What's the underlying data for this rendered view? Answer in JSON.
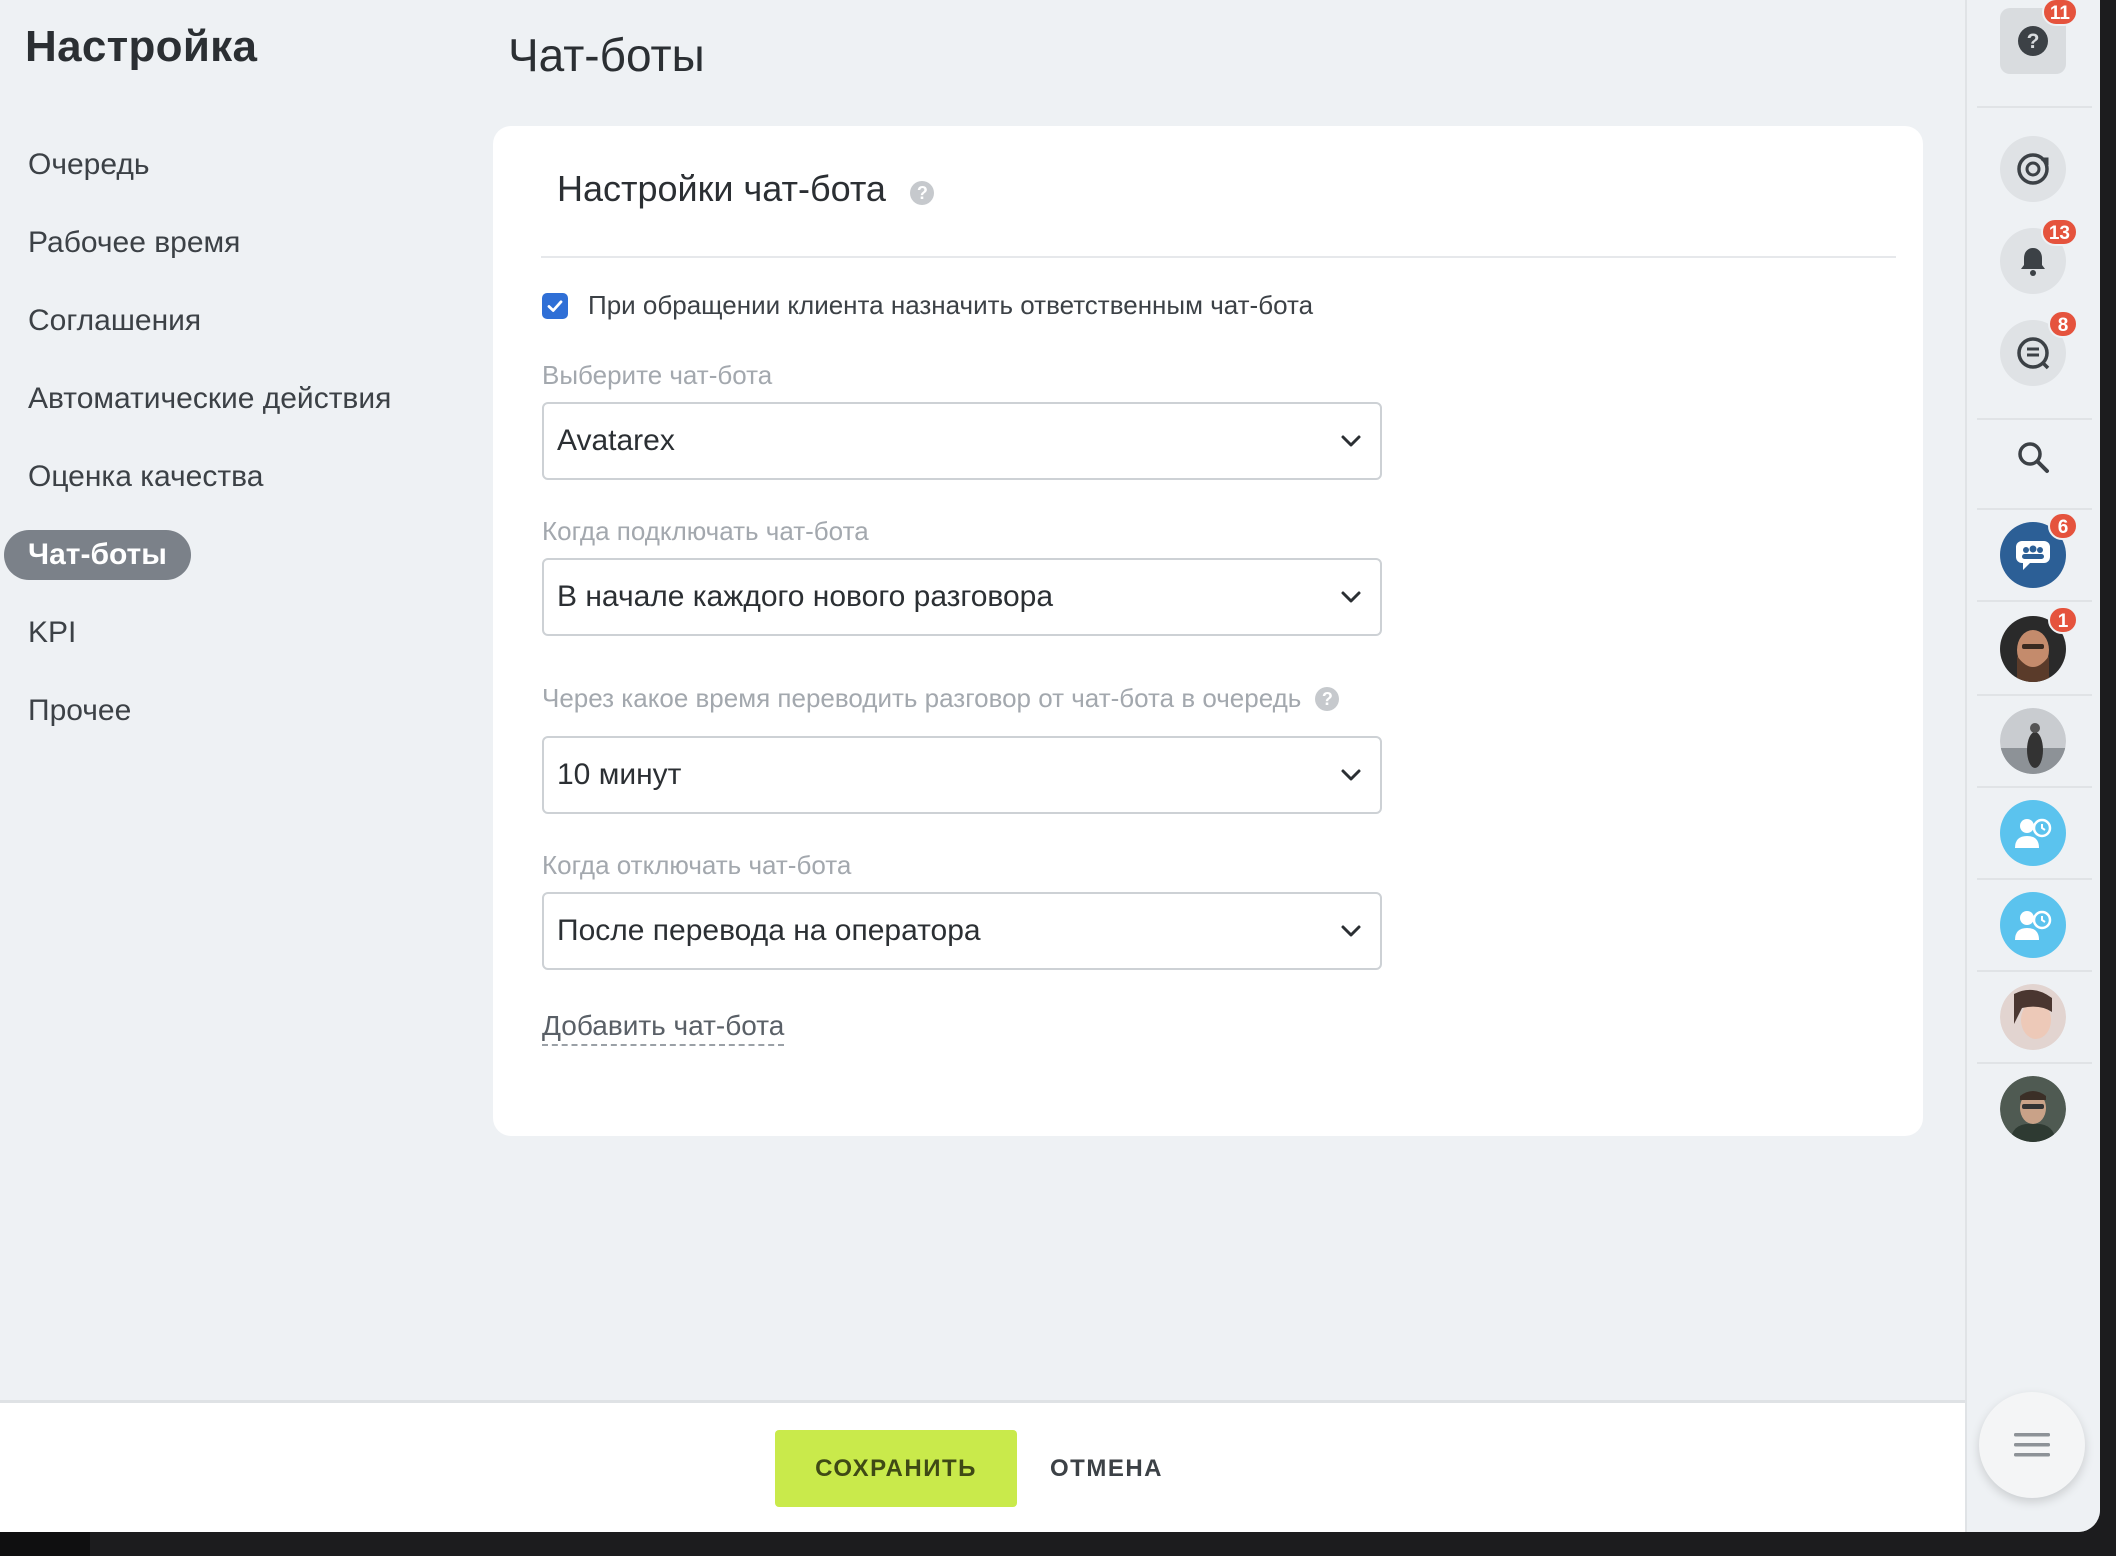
{
  "sidebar": {
    "title": "Настройка",
    "items": [
      {
        "label": "Очередь"
      },
      {
        "label": "Рабочее время"
      },
      {
        "label": "Соглашения"
      },
      {
        "label": "Автоматические действия"
      },
      {
        "label": "Оценка качества"
      },
      {
        "label": "Чат-боты",
        "active": true
      },
      {
        "label": "KPI"
      },
      {
        "label": "Прочее"
      }
    ]
  },
  "page": {
    "title": "Чат-боты"
  },
  "card": {
    "title": "Настройки чат-бота",
    "help_icon": "question-circle-icon",
    "assign_checkbox": {
      "checked": true,
      "label": "При обращении клиента назначить ответственным чат-бота"
    },
    "fields": [
      {
        "label": "Выберите чат-бота",
        "value": "Avatarex"
      },
      {
        "label": "Когда подключать чат-бота",
        "value": "В начале каждого нового разговора"
      },
      {
        "label": "Через какое время переводить разговор от чат-бота в очередь",
        "value": "10 минут",
        "has_help": true
      },
      {
        "label": "Когда отключать чат-бота",
        "value": "После перевода на оператора"
      }
    ],
    "add_link": "Добавить чат-бота"
  },
  "footer": {
    "save_label": "СОХРАНИТЬ",
    "cancel_label": "ОТМЕНА"
  },
  "rail": {
    "help": {
      "icon": "question-icon",
      "badge": "11"
    },
    "refresh": {
      "icon": "refresh-icon"
    },
    "notifications": {
      "icon": "bell-icon",
      "badge": "13"
    },
    "chats": {
      "icon": "chat-list-icon",
      "badge": "8"
    },
    "search": {
      "icon": "search-icon"
    },
    "group": {
      "icon": "group-chat-icon",
      "badge": "6"
    },
    "avatar1": {
      "badge": "1"
    },
    "menu": {
      "icon": "menu-icon"
    }
  },
  "colors": {
    "accent_save": "#c9ea4b",
    "active_nav": "#7b8189",
    "checkbox": "#2f6fd6",
    "badge": "#e5533d",
    "group_chat": "#2c5f96",
    "waiting_user": "#5bc3ee"
  }
}
